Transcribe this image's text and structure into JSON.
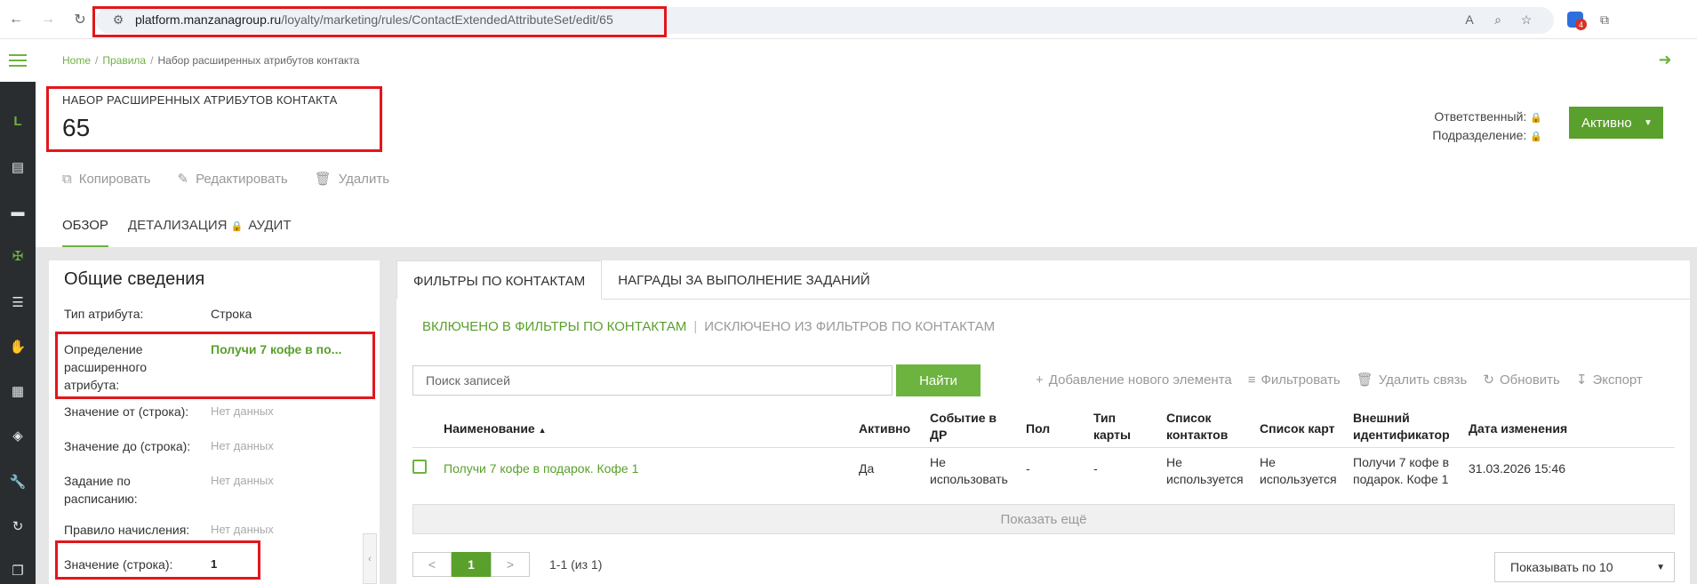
{
  "browser": {
    "url_host": "platform.manzanagroup.ru",
    "url_path": "/loyalty/marketing/rules/ContactExtendedAttributeSet/edit/65",
    "ext_badge_count": "4"
  },
  "breadcrumb": {
    "home": "Home",
    "rules": "Правила",
    "current": "Набор расширенных атрибутов контакта"
  },
  "header": {
    "subtitle": "НАБОР РАСШИРЕННЫХ АТРИБУТОВ КОНТАКТА",
    "title": "65",
    "responsible_label": "Ответственный:",
    "division_label": "Подразделение:",
    "status_label": "Активно"
  },
  "toolbar": {
    "copy": "Копировать",
    "edit": "Редактировать",
    "delete": "Удалить"
  },
  "tabs": {
    "overview": "ОБЗОР",
    "details": "ДЕТАЛИЗАЦИЯ",
    "audit": "АУДИТ"
  },
  "general": {
    "title": "Общие сведения",
    "rows": [
      {
        "label": "Тип атрибута:",
        "value": "Строка"
      },
      {
        "label": "Определение расширенного атрибута:",
        "value": "Получи 7 кофе в по..."
      },
      {
        "label": "Значение от (строка):",
        "value": "Нет данных"
      },
      {
        "label": "Значение до (строка):",
        "value": "Нет данных"
      },
      {
        "label": "Задание по расписанию:",
        "value": "Нет данных"
      },
      {
        "label": "Правило начисления:",
        "value": "Нет данных"
      },
      {
        "label": "Значение (строка):",
        "value": "1"
      }
    ]
  },
  "right": {
    "tabs": [
      "ФИЛЬТРЫ ПО КОНТАКТАМ",
      "НАГРАДЫ ЗА ВЫПОЛНЕНИЕ ЗАДАНИЙ"
    ],
    "sub_included": "ВКЛЮЧЕНО В ФИЛЬТРЫ ПО КОНТАКТАМ",
    "sub_excluded": "ИСКЛЮЧЕНО ИЗ ФИЛЬТРОВ ПО КОНТАКТАМ",
    "search_placeholder": "Поиск записей",
    "find_button": "Найти",
    "actions": {
      "add": "Добавление нового элемента",
      "filter": "Фильтровать",
      "unlink": "Удалить связь",
      "refresh": "Обновить",
      "export": "Экспорт"
    },
    "columns": {
      "name": "Наименование",
      "active": "Активно",
      "birthday": "Событие в ДР",
      "gender": "Пол",
      "card_type": "Тип карты",
      "contact_list": "Список контактов",
      "card_list": "Список карт",
      "external_id": "Внешний идентификатор",
      "modified": "Дата изменения"
    },
    "row": {
      "name": "Получи 7 кофе в подарок. Кофе 1",
      "active": "Да",
      "birthday": "Не использовать",
      "gender": "-",
      "card_type": "-",
      "contact_list": "Не используется",
      "card_list": "Не используется",
      "external_id": "Получи 7 кофе в подарок. Кофе 1",
      "modified": "31.03.2026 15:46"
    },
    "show_more": "Показать ещё",
    "pager": {
      "prev": "<",
      "current": "1",
      "next": ">",
      "info": "1-1 (из 1)"
    },
    "per_page": "Показывать по 10"
  }
}
